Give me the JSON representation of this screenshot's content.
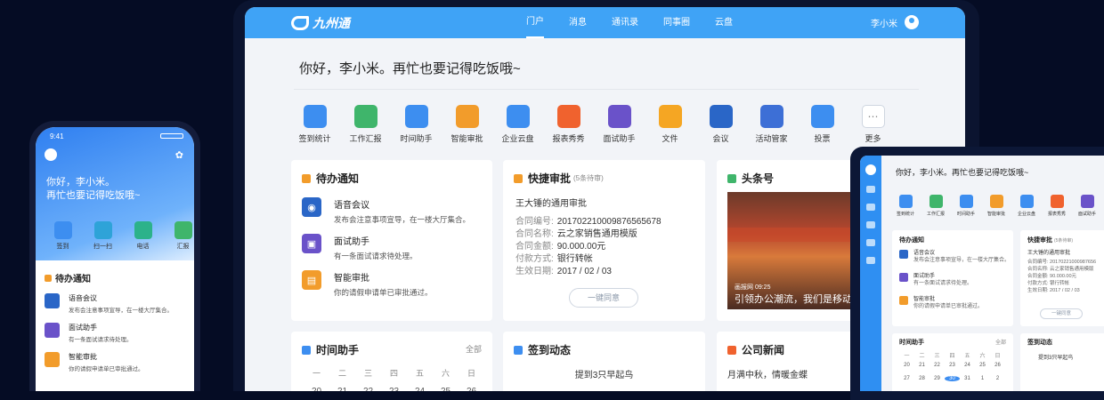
{
  "brand": {
    "name": "九州通"
  },
  "nav": [
    "门户",
    "消息",
    "通讯录",
    "同事圈",
    "云盘"
  ],
  "user": {
    "name": "李小米"
  },
  "greeting": "你好，李小米。再忙也要记得吃饭哦~",
  "apps": [
    {
      "label": "签到统计",
      "color": "#3d8ef0",
      "icon": "location-icon"
    },
    {
      "label": "工作汇报",
      "color": "#3fb56b",
      "icon": "calendar-icon"
    },
    {
      "label": "时间助手",
      "color": "#3d8ef0",
      "icon": "check-icon"
    },
    {
      "label": "智能审批",
      "color": "#f29c2b",
      "icon": "document-icon"
    },
    {
      "label": "企业云盘",
      "color": "#3d8ef0",
      "icon": "folder-icon"
    },
    {
      "label": "报表秀秀",
      "color": "#f0622e",
      "icon": "chart-icon"
    },
    {
      "label": "面试助手",
      "color": "#6a52c9",
      "icon": "interview-icon"
    },
    {
      "label": "文件",
      "color": "#f5a623",
      "icon": "file-folder-icon"
    },
    {
      "label": "会议",
      "color": "#2a66c7",
      "icon": "meeting-icon"
    },
    {
      "label": "活动管家",
      "color": "#3d6fd6",
      "icon": "people-icon"
    },
    {
      "label": "投票",
      "color": "#3d8ef0",
      "icon": "vote-icon"
    },
    {
      "label": "更多",
      "color": "#ffffff",
      "icon": "more-icon"
    }
  ],
  "todo": {
    "title": "待办通知",
    "items": [
      {
        "title": "语音会议",
        "desc": "发布会注意事项宣导，在一楼大厅集合。",
        "color": "#2a66c7"
      },
      {
        "title": "面试助手",
        "desc": "有一条面试请求待处理。",
        "color": "#6a52c9"
      },
      {
        "title": "智能审批",
        "desc": "你的请假申请单已审批通过。",
        "color": "#f29c2b"
      }
    ]
  },
  "approval": {
    "title": "快捷审批",
    "count": "(5条待审)",
    "subject": "王大锤的通用审批",
    "fields": [
      {
        "k": "合同编号:",
        "v": "20170221000987656567 8"
      },
      {
        "k": "合同名称:",
        "v": "云之家销售通用模版"
      },
      {
        "k": "合同金额:",
        "v": "90.000.00元"
      },
      {
        "k": "付款方式:",
        "v": "银行转帐"
      },
      {
        "k": "生效日期:",
        "v": "2017 / 02 / 03"
      }
    ],
    "button": "一键同意"
  },
  "headline": {
    "title": "头条号",
    "caption": "引领办公潮流，我们是移动办",
    "tag": "画报网 09:25"
  },
  "time_helper": {
    "title": "时间助手",
    "all": "全部",
    "weekdays": [
      "一",
      "二",
      "三",
      "四",
      "五",
      "六",
      "日"
    ],
    "days": [
      "20",
      "21",
      "22",
      "23",
      "24",
      "25",
      "26"
    ]
  },
  "checkin": {
    "title": "签到动态",
    "text": "提到3只早起鸟"
  },
  "news": {
    "title": "公司新闻",
    "text": "月满中秋，情暖金蝶"
  },
  "phone": {
    "time": "9:41",
    "greeting1": "你好，李小米。",
    "greeting2": "再忙也要记得吃饭哦~",
    "apps": [
      "签到",
      "扫一扫",
      "电话",
      "汇报"
    ],
    "todo_title": "待办通知",
    "items": [
      {
        "t": "语音会议",
        "d": "发布会注意事项宣导，在一楼大厅集合。",
        "color": "#2a66c7"
      },
      {
        "t": "面试助手",
        "d": "有一条面试请求待处理。",
        "color": "#6a52c9"
      },
      {
        "t": "智能审批",
        "d": "你的请假申请单已审批通过。",
        "color": "#f29c2b"
      }
    ]
  },
  "tablet": {
    "greeting": "你好，李小米。再忙也要记得吃饭哦~",
    "apps": [
      "签到统计",
      "工作汇报",
      "时间助手",
      "智能审批",
      "企业云盘",
      "报表秀秀",
      "面试助手"
    ],
    "todo_title": "待办通知",
    "approval_title": "快捷审批",
    "approval_count": "(5条待审)",
    "approval_subject": "王大锤的通用审批",
    "fields": [
      "合同编号: 20170221000987656",
      "合同名称: 云之家销售通用模版",
      "合同金额: 90.000.00元",
      "付款方式: 银行转帐",
      "生效日期: 2017 / 02 / 03"
    ],
    "button": "一键同意",
    "time_title": "时间助手",
    "all": "全部",
    "checkin_title": "签到动态",
    "checkin_text": "提到3只早起鸟",
    "items": [
      {
        "t": "语音会议",
        "d": "发布会注意事项宣导，在一楼大厅集合。"
      },
      {
        "t": "面试助手",
        "d": "有一条面试请求待处理。"
      },
      {
        "t": "智能审批",
        "d": "你的请假申请单已审批通过。"
      }
    ],
    "cal1": [
      "一",
      "二",
      "三",
      "四",
      "五",
      "六",
      "日"
    ],
    "cal2": [
      "20",
      "21",
      "22",
      "23",
      "24",
      "25",
      "26"
    ],
    "cal3": [
      "27",
      "28",
      "29",
      "30",
      "31",
      "1",
      "2"
    ]
  }
}
